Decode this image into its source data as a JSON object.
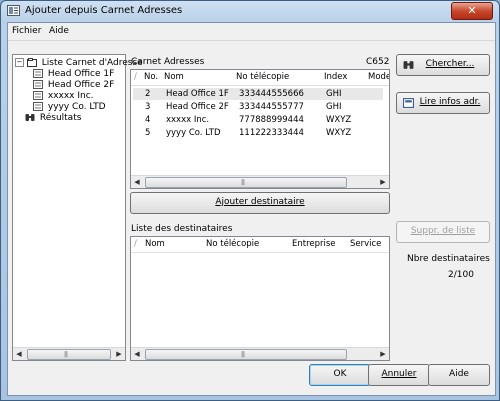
{
  "window": {
    "title": "Ajouter depuis Carnet Adresses",
    "close_glyph": "✕"
  },
  "menu": [
    {
      "label": "Fichier"
    },
    {
      "label": "Aide"
    }
  ],
  "tree": {
    "root": "Liste Carnet d'Adresse",
    "items": [
      {
        "label": "Head Office 1F"
      },
      {
        "label": "Head Office 2F"
      },
      {
        "label": "xxxxx Inc."
      },
      {
        "label": "yyyy Co. LTD"
      }
    ],
    "results": "Résultats"
  },
  "address_book": {
    "title": "Carnet Adresses",
    "model": "C652",
    "columns": {
      "sort": "/",
      "no": "No.",
      "name": "Nom",
      "fax": "No télécopie",
      "index": "Index",
      "mode": "Mode"
    },
    "rows": [
      {
        "no": "2",
        "name": "Head Office 1F",
        "fax": "333444555666",
        "index": "GHI"
      },
      {
        "no": "3",
        "name": "Head Office 2F",
        "fax": "333444555777",
        "index": "GHI"
      },
      {
        "no": "4",
        "name": "xxxxx Inc.",
        "fax": "777888999444",
        "index": "WXYZ"
      },
      {
        "no": "5",
        "name": "yyyy Co. LTD",
        "fax": "111222333444",
        "index": "WXYZ"
      }
    ]
  },
  "buttons": {
    "search": "Chercher...",
    "read_info": "Lire infos adr.",
    "add_dest": "Ajouter destinataire",
    "delete_list": "Suppr. de liste",
    "ok": "OK",
    "cancel": "Annuler",
    "help": "Aide"
  },
  "dest_list": {
    "title": "Liste des destinataires",
    "columns": {
      "sort": "/",
      "name": "Nom",
      "fax": "No télécopie",
      "company": "Entreprise",
      "service": "Service"
    }
  },
  "dest_count": {
    "label": "Nbre destinataires",
    "value": "2/100"
  },
  "colors": {
    "selected_row": "#e8e8e8",
    "title_bar": "#b9d0e8",
    "close_button": "#c8482e"
  }
}
